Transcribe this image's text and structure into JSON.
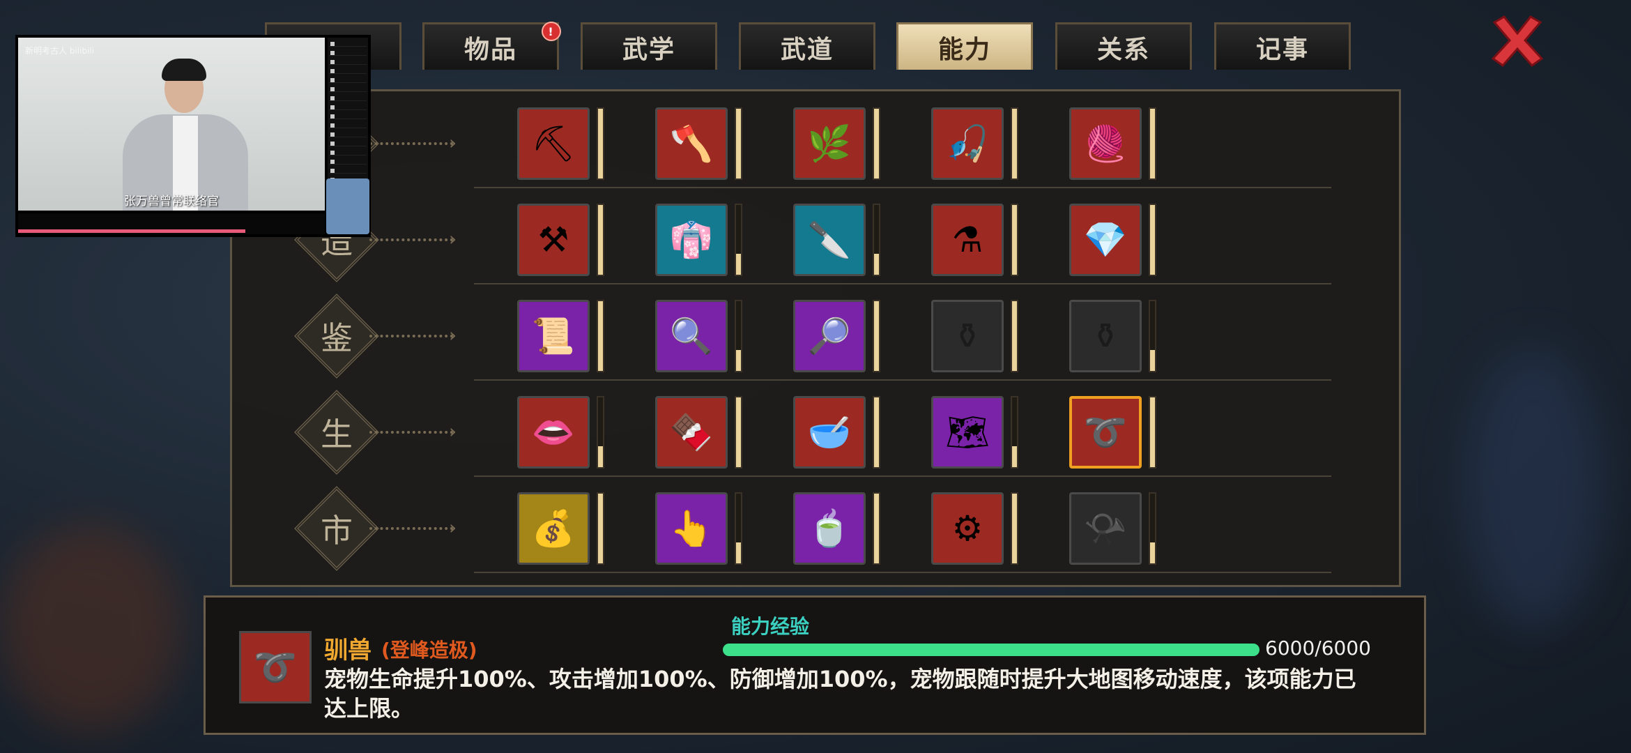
{
  "tabs": [
    {
      "label": "",
      "active": false,
      "badge": false
    },
    {
      "label": "物品",
      "active": false,
      "badge": true,
      "badge_text": "!"
    },
    {
      "label": "武学",
      "active": false,
      "badge": false
    },
    {
      "label": "武道",
      "active": false,
      "badge": false
    },
    {
      "label": "能力",
      "active": true,
      "badge": false
    },
    {
      "label": "关系",
      "active": false,
      "badge": false
    },
    {
      "label": "记事",
      "active": false,
      "badge": false
    }
  ],
  "close_icon": "close-x-icon",
  "rows": [
    {
      "category": "",
      "skills": [
        {
          "icon": "ore-pickaxe-icon",
          "glyph": "⛏",
          "color": "red",
          "level": 1.0
        },
        {
          "icon": "wood-axe-icon",
          "glyph": "🪓",
          "color": "red",
          "level": 1.0
        },
        {
          "icon": "herb-basket-icon",
          "glyph": "🌿",
          "color": "red",
          "level": 1.0
        },
        {
          "icon": "fishing-icon",
          "glyph": "🎣",
          "color": "red",
          "level": 1.0
        },
        {
          "icon": "weaving-icon",
          "glyph": "🧶",
          "color": "red",
          "level": 1.0
        }
      ]
    },
    {
      "category": "造",
      "skills": [
        {
          "icon": "anvil-icon",
          "glyph": "⚒",
          "color": "red",
          "level": 1.0
        },
        {
          "icon": "tailoring-icon",
          "glyph": "👘",
          "color": "teal",
          "level": 0.3
        },
        {
          "icon": "cooking-icon",
          "glyph": "🔪",
          "color": "teal",
          "level": 0.3
        },
        {
          "icon": "alchemy-icon",
          "glyph": "⚗",
          "color": "red",
          "level": 1.0
        },
        {
          "icon": "gem-icon",
          "glyph": "💎",
          "color": "red",
          "level": 1.0
        }
      ]
    },
    {
      "category": "鉴",
      "skills": [
        {
          "icon": "appraise-scroll-icon",
          "glyph": "📜",
          "color": "purple",
          "level": 1.0
        },
        {
          "icon": "appraise-paper-icon",
          "glyph": "🔍",
          "color": "purple",
          "level": 0.3
        },
        {
          "icon": "appraise-tool-icon",
          "glyph": "🔎",
          "color": "purple",
          "level": 1.0
        },
        {
          "icon": "appraise-locked-icon",
          "glyph": "⚱",
          "color": "dark",
          "level": 1.0
        },
        {
          "icon": "appraise-locked-2-icon",
          "glyph": "⚱",
          "color": "dark",
          "level": 0.3
        }
      ]
    },
    {
      "category": "生",
      "skills": [
        {
          "icon": "medicine-icon",
          "glyph": "👄",
          "color": "red",
          "level": 0.3
        },
        {
          "icon": "abacus-icon",
          "glyph": "🍫",
          "color": "red",
          "level": 1.0
        },
        {
          "icon": "bowl-icon",
          "glyph": "🥣",
          "color": "red",
          "level": 1.0
        },
        {
          "icon": "map-icon",
          "glyph": "🗺",
          "color": "purple",
          "level": 0.3
        },
        {
          "icon": "whip-icon",
          "glyph": "➰",
          "color": "red",
          "level": 1.0,
          "selected": true
        }
      ]
    },
    {
      "category": "市",
      "skills": [
        {
          "icon": "money-bag-icon",
          "glyph": "💰",
          "color": "gold",
          "level": 1.0
        },
        {
          "icon": "finger-icon",
          "glyph": "👆",
          "color": "purple",
          "level": 0.3
        },
        {
          "icon": "tea-icon",
          "glyph": "🍵",
          "color": "purple",
          "level": 1.0
        },
        {
          "icon": "gear-icon",
          "glyph": "⚙",
          "color": "red",
          "level": 1.0
        },
        {
          "icon": "horn-locked-icon",
          "glyph": "📯",
          "color": "dark",
          "level": 0.3
        }
      ]
    }
  ],
  "detail": {
    "icon": "whip-icon",
    "glyph": "➰",
    "name": "驯兽",
    "rank": "(登峰造极)",
    "exp_label": "能力经验",
    "exp_current": 6000,
    "exp_max": 6000,
    "exp_text": "6000/6000",
    "description": "宠物生命提升100%、攻击增加100%、防御增加100%，宠物跟随时提升大地图移动速度，该项能力已达上限。"
  },
  "video_overlay": {
    "subtitle": "张万兽曾常联络官",
    "watermark": "新明考古人 bilibili",
    "progress": 0.74
  }
}
